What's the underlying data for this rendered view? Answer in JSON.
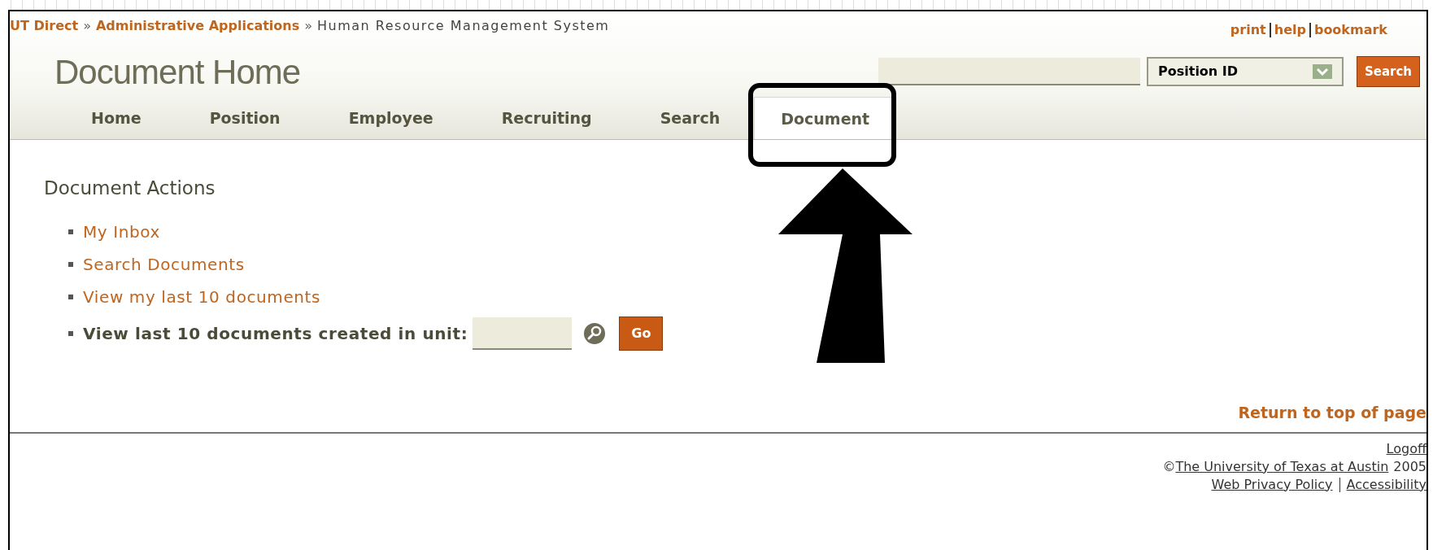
{
  "breadcrumb": [
    {
      "text": "UT Direct",
      "kind": "link"
    },
    {
      "text": "»",
      "kind": "separator"
    },
    {
      "text": "Administrative Applications",
      "kind": "link"
    },
    {
      "text": "»",
      "kind": "separator"
    },
    {
      "text": "Human Resource Management System",
      "kind": "current"
    }
  ],
  "utility_links": [
    "print",
    "help",
    "bookmark"
  ],
  "page_title": "Document Home",
  "search": {
    "category": "Position ID",
    "button": "Search"
  },
  "tabs": [
    {
      "label": "Home",
      "selected": false
    },
    {
      "label": "Position",
      "selected": false
    },
    {
      "label": "Employee",
      "selected": false
    },
    {
      "label": "Recruiting",
      "selected": false
    },
    {
      "label": "Search",
      "selected": false
    },
    {
      "label": "Document",
      "selected": true
    }
  ],
  "section_title": "Document Actions",
  "actions": [
    {
      "kind": "link",
      "label": "My Inbox"
    },
    {
      "kind": "link",
      "label": "Search Documents"
    },
    {
      "kind": "link",
      "label": "View my last 10 documents"
    },
    {
      "kind": "form",
      "label": "View last 10 documents created in unit:",
      "button": "Go"
    }
  ],
  "return_link": "Return to top of page",
  "footer": {
    "logoff": "Logoff",
    "copyright_symbol": "©",
    "university": "The University of Texas at Austin",
    "year": "2005",
    "links": [
      "Web Privacy Policy",
      "Accessibility"
    ]
  },
  "annotation": {
    "kind": "highlight-arrow"
  }
}
